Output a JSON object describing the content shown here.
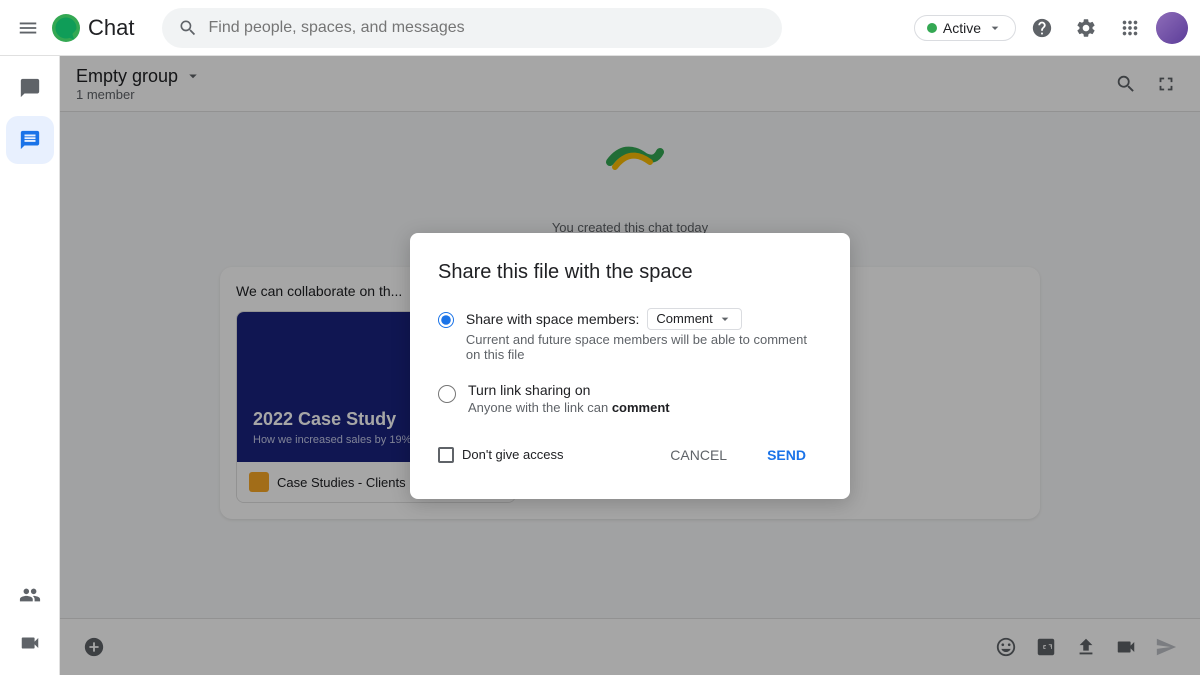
{
  "topbar": {
    "title": "Chat",
    "search_placeholder": "Find people, spaces, and messages",
    "active_label": "Active"
  },
  "sidebar": {
    "chat_icon_label": "Chat",
    "dm_icon_label": "Direct messages"
  },
  "chat_header": {
    "title": "Empty group",
    "members": "1 member"
  },
  "chat_body": {
    "created_text": "You created this chat today",
    "message_text": "We can collaborate on th"
  },
  "card": {
    "title": "2022 Case Study",
    "subtitle": "How we increased sales by 19%",
    "file_name": "Case Studies - Clients in June"
  },
  "dialog": {
    "title": "Share this file with the space",
    "option1_label": "Share with space members:",
    "option1_desc": "Current and future space members will be able to comment on this file",
    "option1_permission": "Comment",
    "option2_label": "Turn link sharing on",
    "option2_desc_pre": "Anyone with the link can ",
    "option2_desc_bold": "comment",
    "dont_give_label": "Don't give access",
    "cancel_label": "CANCEL",
    "send_label": "SEND"
  }
}
